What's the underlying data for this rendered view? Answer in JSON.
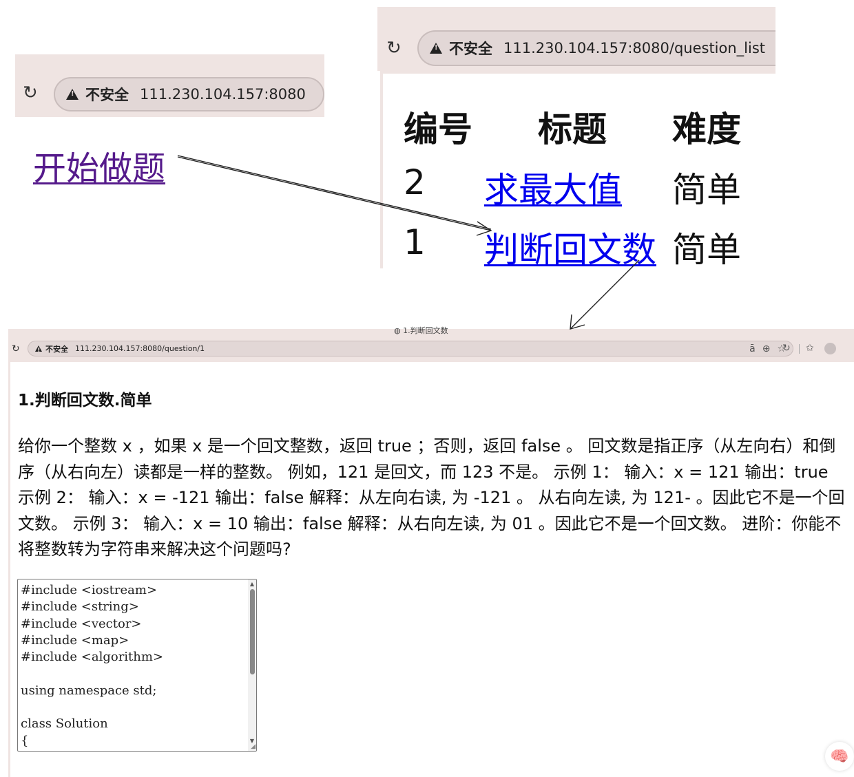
{
  "home": {
    "insecure_label": "不安全",
    "url": "111.230.104.157:8080",
    "start_link": "开始做题"
  },
  "question_list": {
    "insecure_label": "不安全",
    "url": "111.230.104.157:8080/question_list",
    "headers": [
      "编号",
      "标题",
      "难度"
    ],
    "rows": [
      {
        "id": "2",
        "title": "求最大值",
        "difficulty": "简单"
      },
      {
        "id": "1",
        "title": "判断回文数",
        "difficulty": "简单"
      }
    ]
  },
  "question_detail": {
    "tab_title": "1.判断回文数",
    "insecure_label": "不安全",
    "url": "111.230.104.157:8080/question/1",
    "heading": "1.判断回文数.简单",
    "description": "给你一个整数 x ，如果 x 是一个回文整数，返回 true ；否则，返回 false 。 回文数是指正序（从左向右）和倒序（从右向左）读都是一样的整数。 例如，121 是回文，而 123 不是。 示例 1： 输入：x = 121 输出：true 示例 2： 输入：x = -121 输出：false 解释：从左向右读, 为 -121 。 从右向左读, 为 121- 。因此它不是一个回文数。 示例 3： 输入：x = 10 输出：false 解释：从右向左读, 为 01 。因此它不是一个回文数。 进阶：你能不将整数转为字符串来解决这个问题吗?",
    "code": "#include <iostream>\n#include <string>\n#include <vector>\n#include <map>\n#include <algorithm>\n\nusing namespace std;\n\nclass Solution\n{"
  }
}
